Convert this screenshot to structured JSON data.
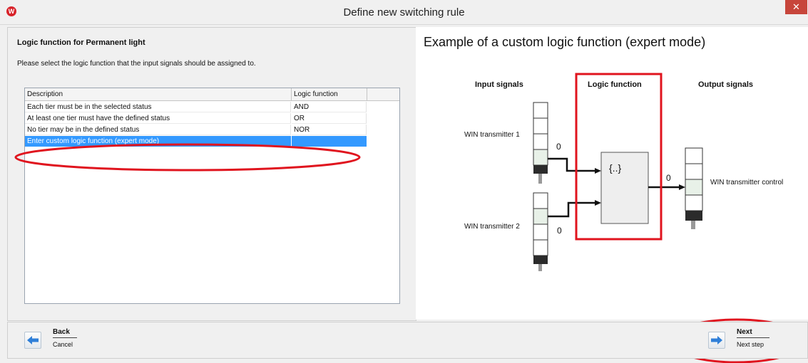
{
  "window": {
    "title": "Define new switching rule",
    "close_glyph": "✕",
    "logo_glyph": "W"
  },
  "left": {
    "heading": "Logic function for Permanent light",
    "instruction": "Please select the logic function that the input signals should be assigned to.",
    "table": {
      "headers": [
        "Description",
        "Logic function"
      ],
      "rows": [
        {
          "description": "Each tier must be in the selected status",
          "logic": "AND",
          "selected": false
        },
        {
          "description": "At least one tier must have the defined status",
          "logic": "OR",
          "selected": false
        },
        {
          "description": "No tier may be in the defined status",
          "logic": "NOR",
          "selected": false
        },
        {
          "description": "Enter custom logic function (expert mode)",
          "logic": "",
          "selected": true
        }
      ]
    }
  },
  "right": {
    "title": "Example of a custom logic function (expert mode)",
    "diagram": {
      "input_header": "Input signals",
      "logic_header": "Logic function",
      "output_header": "Output signals",
      "transmitter1": "WIN transmitter 1",
      "transmitter2": "WIN transmitter 2",
      "control": "WIN transmitter control",
      "signal1": "0",
      "signal2": "0",
      "signal_out": "0",
      "logic_box": "{..}"
    }
  },
  "footer": {
    "back": {
      "label": "Back",
      "sub": "Cancel",
      "icon": "arrow-left-icon"
    },
    "next": {
      "label": "Next",
      "sub": "Next step",
      "icon": "arrow-right-icon"
    }
  },
  "colors": {
    "selection": "#3399ff",
    "highlight_red": "#e0141e",
    "arrow_blue": "#2f7fd8"
  }
}
